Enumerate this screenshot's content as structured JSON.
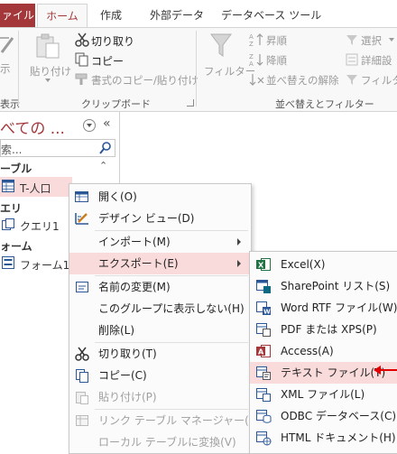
{
  "tabs": {
    "file": "ァイル",
    "home": "ホーム",
    "create": "作成",
    "external": "外部データ",
    "dbtools": "データベース ツール"
  },
  "ribbon": {
    "view_label": "示",
    "view_group": "表示",
    "paste": "貼り付け",
    "cut": "切り取り",
    "copy": "コピー",
    "format_painter": "書式のコピー/貼り付け",
    "clipboard_group": "クリップボード",
    "filter": "フィルター",
    "ascending": "昇順",
    "descending": "降順",
    "clear_sort": "並べ替えの解除",
    "sort_group": "並べ替えとフィルター",
    "selection": "選択",
    "advanced": "詳細設",
    "filter_toggle": "フィルター"
  },
  "nav": {
    "title": "べての ...",
    "search_placeholder": "索...",
    "section_tables": "ーブル",
    "table_item": "T-人口",
    "section_queries": "エリ",
    "query_item": "クエリ1",
    "section_forms": "ォーム",
    "form_item": "フォーム1"
  },
  "context_menu": {
    "items": [
      {
        "label": "開く(O)",
        "enabled": true,
        "has_submenu": false,
        "highlighted": false
      },
      {
        "label": "デザイン ビュー(D)",
        "enabled": true,
        "has_submenu": false,
        "highlighted": false
      },
      {
        "label": "インポート(M)",
        "enabled": true,
        "has_submenu": true,
        "highlighted": false
      },
      {
        "label": "エクスポート(E)",
        "enabled": true,
        "has_submenu": true,
        "highlighted": true
      },
      {
        "label": "名前の変更(M)",
        "enabled": true,
        "has_submenu": false,
        "highlighted": false
      },
      {
        "label": "このグループに表示しない(H)",
        "enabled": true,
        "has_submenu": false,
        "highlighted": false
      },
      {
        "label": "削除(L)",
        "enabled": true,
        "has_submenu": false,
        "highlighted": false
      },
      {
        "label": "切り取り(T)",
        "enabled": true,
        "has_submenu": false,
        "highlighted": false
      },
      {
        "label": "コピー(C)",
        "enabled": true,
        "has_submenu": false,
        "highlighted": false
      },
      {
        "label": "貼り付け(P)",
        "enabled": false,
        "has_submenu": false,
        "highlighted": false
      },
      {
        "label": "リンク テーブル マネージャー(K)",
        "enabled": false,
        "has_submenu": false,
        "highlighted": false
      },
      {
        "label": "ローカル テーブルに変換(V)",
        "enabled": false,
        "has_submenu": false,
        "highlighted": false
      }
    ]
  },
  "export_menu": {
    "items": [
      {
        "label": "Excel(X)",
        "highlighted": false
      },
      {
        "label": "SharePoint リスト(S)",
        "highlighted": false
      },
      {
        "label": "Word RTF ファイル(W)",
        "highlighted": false
      },
      {
        "label": "PDF または XPS(P)",
        "highlighted": false
      },
      {
        "label": "Access(A)",
        "highlighted": false
      },
      {
        "label": "テキスト ファイル(T)",
        "highlighted": true
      },
      {
        "label": "XML ファイル(L)",
        "highlighted": false
      },
      {
        "label": "ODBC データベース(C)",
        "highlighted": false
      },
      {
        "label": "HTML ドキュメント(H)",
        "highlighted": false
      }
    ]
  },
  "colors": {
    "accent": "#a4373a",
    "highlight": "#fadbdb",
    "annotation_arrow": "#e00000"
  }
}
